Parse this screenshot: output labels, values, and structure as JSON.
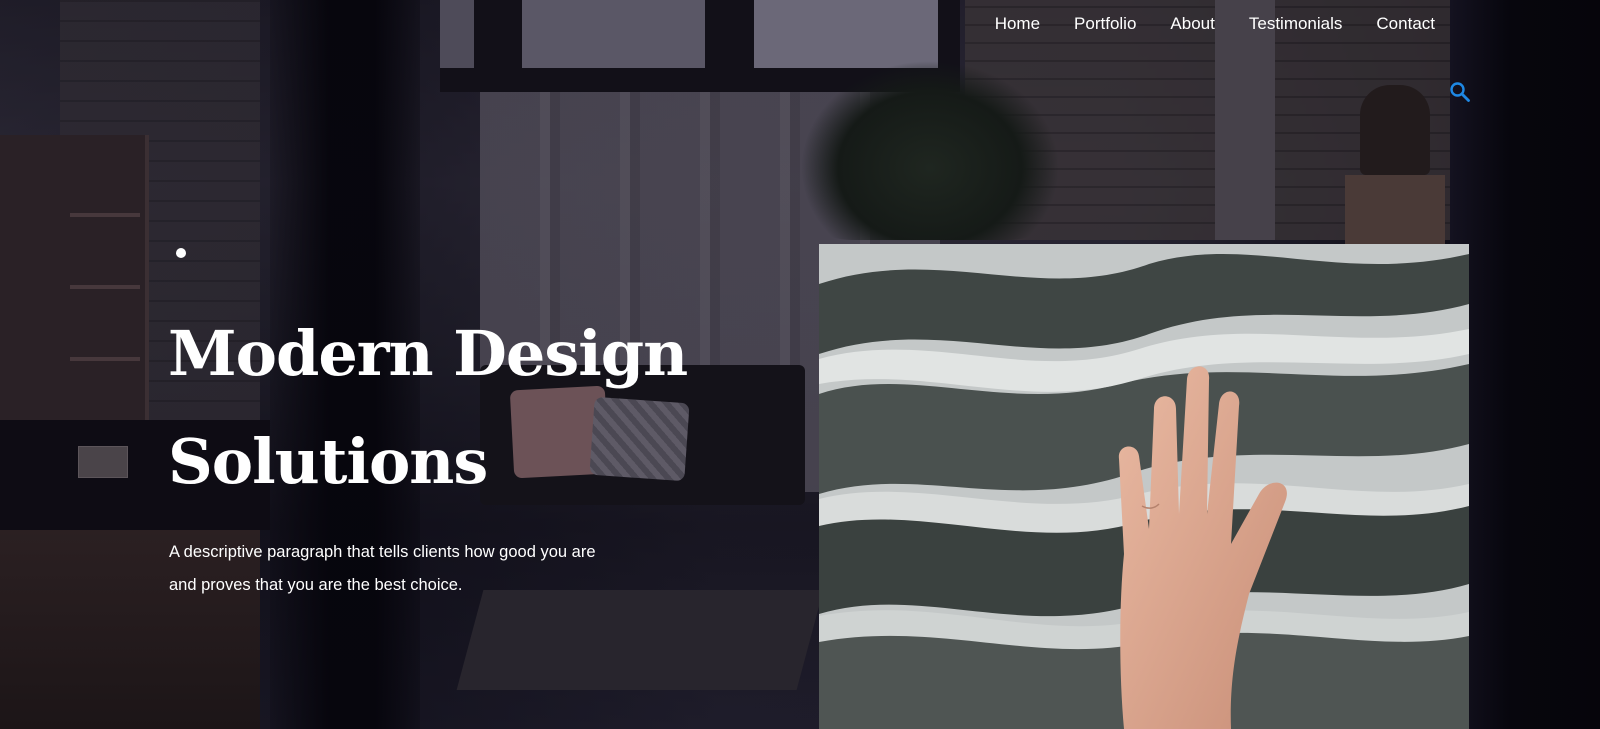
{
  "nav": {
    "items": [
      "Home",
      "Portfolio",
      "About",
      "Testimonials",
      "Contact"
    ],
    "search_icon": "search-icon",
    "accent_color": "#1e88e5"
  },
  "hero": {
    "title_line1": "Modern Design",
    "title_line2": "Solutions",
    "description_line1": "A descriptive paragraph that tells clients how good you are",
    "description_line2": "and proves that you are the best choice.",
    "image_subject": "hand on marble stone"
  }
}
